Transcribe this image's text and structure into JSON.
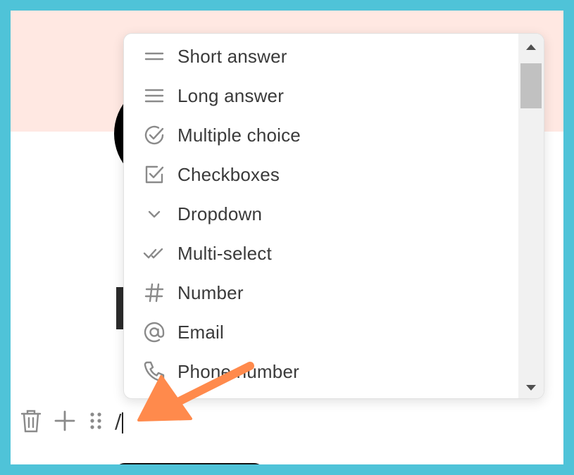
{
  "menu": {
    "items": [
      {
        "label": "Short answer",
        "icon": "short-answer-icon"
      },
      {
        "label": "Long answer",
        "icon": "long-answer-icon"
      },
      {
        "label": "Multiple choice",
        "icon": "multiple-choice-icon"
      },
      {
        "label": "Checkboxes",
        "icon": "checkbox-icon"
      },
      {
        "label": "Dropdown",
        "icon": "chevron-down-icon"
      },
      {
        "label": "Multi-select",
        "icon": "double-check-icon"
      },
      {
        "label": "Number",
        "icon": "hash-icon"
      },
      {
        "label": "Email",
        "icon": "at-icon"
      },
      {
        "label": "Phone number",
        "icon": "phone-icon"
      }
    ]
  },
  "editor": {
    "slash_text": "/"
  },
  "colors": {
    "frame": "#4fc3d8",
    "banner": "#ffe8e2",
    "annotation_arrow": "#ff8a4c",
    "icon_gray": "#8a8a8a"
  }
}
